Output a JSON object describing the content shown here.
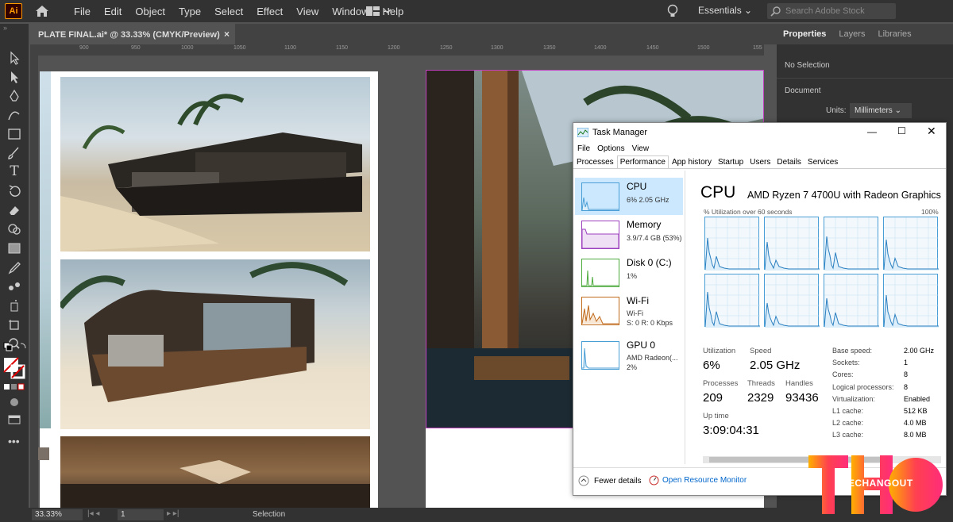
{
  "app": {
    "logo": "Ai"
  },
  "menu": [
    "File",
    "Edit",
    "Object",
    "Type",
    "Select",
    "Effect",
    "View",
    "Window",
    "Help"
  ],
  "workspace": "Essentials",
  "search": {
    "placeholder": "Search Adobe Stock"
  },
  "document_tab": {
    "title": "PLATE FINAL.ai* @ 33.33% (CMYK/Preview)",
    "close": "×"
  },
  "ruler_ticks": [
    "900",
    "950",
    "1000",
    "1050",
    "1100",
    "1150",
    "1200",
    "1250",
    "1300",
    "1350",
    "1400",
    "1450",
    "1500",
    "155"
  ],
  "panel": {
    "tabs": [
      "Properties",
      "Layers",
      "Libraries"
    ],
    "no_selection": "No Selection",
    "document_label": "Document",
    "units_label": "Units:",
    "units_value": "Millimeters"
  },
  "status": {
    "zoom": "33.33%",
    "artboard": "1",
    "tool": "Selection"
  },
  "task_manager": {
    "title": "Task Manager",
    "menu": [
      "File",
      "Options",
      "View"
    ],
    "tabs": [
      "Processes",
      "Performance",
      "App history",
      "Startup",
      "Users",
      "Details",
      "Services"
    ],
    "sidebar": [
      {
        "name": "CPU",
        "line1": "6%  2.05 GHz",
        "line2": "",
        "color": "#4a9ed6"
      },
      {
        "name": "Memory",
        "line1": "3.9/7.4 GB (53%)",
        "line2": "",
        "color": "#9b3fbf"
      },
      {
        "name": "Disk 0 (C:)",
        "line1": "1%",
        "line2": "",
        "color": "#4caa3c"
      },
      {
        "name": "Wi-Fi",
        "line1": "Wi-Fi",
        "line2": "S: 0  R: 0 Kbps",
        "color": "#c06a1c"
      },
      {
        "name": "GPU 0",
        "line1": "AMD Radeon(...",
        "line2": "2%",
        "color": "#4a9ed6"
      }
    ],
    "cpu": {
      "heading": "CPU",
      "model": "AMD Ryzen 7 4700U with Radeon Graphics",
      "util_label": "% Utilization over 60 seconds",
      "util_max": "100%",
      "utilization_label": "Utilization",
      "utilization": "6%",
      "speed_label": "Speed",
      "speed": "2.05 GHz",
      "processes_label": "Processes",
      "processes": "209",
      "threads_label": "Threads",
      "threads": "2329",
      "handles_label": "Handles",
      "handles": "93436",
      "uptime_label": "Up time",
      "uptime": "3:09:04:31",
      "specs": [
        {
          "k": "Base speed:",
          "v": "2.00 GHz"
        },
        {
          "k": "Sockets:",
          "v": "1"
        },
        {
          "k": "Cores:",
          "v": "8"
        },
        {
          "k": "Logical processors:",
          "v": "8"
        },
        {
          "k": "Virtualization:",
          "v": "Enabled"
        },
        {
          "k": "L1 cache:",
          "v": "512 KB"
        },
        {
          "k": "L2 cache:",
          "v": "4.0 MB"
        },
        {
          "k": "L3 cache:",
          "v": "8.0 MB"
        }
      ]
    },
    "footer": {
      "fewer": "Fewer details",
      "monitor": "Open Resource Monitor"
    }
  },
  "watermark": {
    "letters": "THO",
    "text": "TECHANGOUT"
  },
  "colors": {
    "accent_ai": "#ff9a00",
    "tm_select": "#cce8ff",
    "watermark": "#ff2d7a"
  }
}
